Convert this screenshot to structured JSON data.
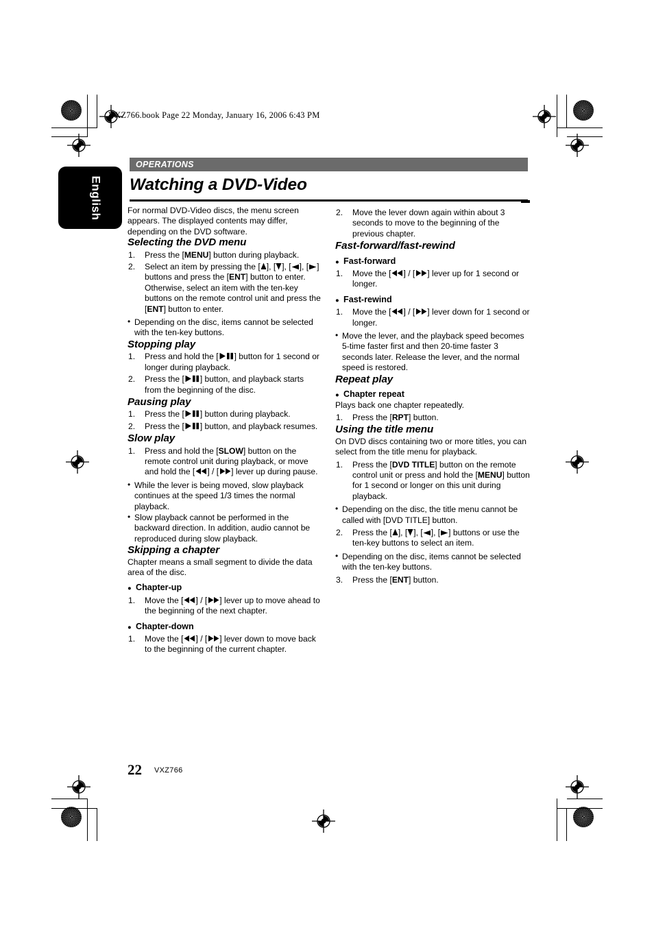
{
  "print_marks": {
    "file_line": "VXZ766.book  Page 22  Monday, January 16, 2006  6:43 PM"
  },
  "language_tab": {
    "label": "English"
  },
  "section_header": {
    "label": "OPERATIONS"
  },
  "page_title": "Watching a DVD-Video",
  "footer": {
    "page_number": "22",
    "model": "VXZ766"
  },
  "icons": {
    "up": "arrow-up-icon",
    "down": "arrow-down-icon",
    "left": "arrow-left-icon",
    "right": "arrow-right-icon",
    "play_pause": "play-pause-icon",
    "rewind": "fast-rewind-icon",
    "forward": "fast-forward-icon"
  },
  "left_column": {
    "intro": "For normal DVD-Video discs, the menu screen appears. The displayed contents may differ, depending on the DVD software.",
    "sections": [
      {
        "heading": "Selecting the DVD menu",
        "steps": [
          "Press the [MENU] button during playback.",
          "Select an item by pressing the [ ▲ ], [ ▼ ], [ ◀ ], [ ▶ ] buttons and press the [ENT] button to enter. Otherwise, select an item with the ten-key buttons on the remote control unit and press the [ENT] button to enter."
        ],
        "notes": [
          "Depending on the disc, items cannot be selected with the ten-key buttons."
        ]
      },
      {
        "heading": "Stopping play",
        "steps": [
          "Press and hold the [ ▶▐▐ ] button for 1 second or longer during playback.",
          "Press the [ ▶▐▐ ] button, and playback starts from the beginning of the disc."
        ],
        "notes": []
      },
      {
        "heading": "Pausing play",
        "steps": [
          "Press the [ ▶▐▐ ] button during playback.",
          "Press the [ ▶▐▐ ] button, and playback resumes."
        ],
        "notes": []
      },
      {
        "heading": "Slow play",
        "steps": [
          "Press and hold the [SLOW] button on the remote control unit during playback, or move and hold the [ ◀◀ ] / [ ▶▶ ] lever up during pause."
        ],
        "notes": [
          "While the lever is being moved, slow playback continues at the speed 1/3 times the normal playback.",
          "Slow playback cannot be performed in the backward direction. In addition, audio cannot be reproduced during slow playback."
        ]
      },
      {
        "heading": "Skipping a chapter",
        "lead": "Chapter means a small segment to divide the data area of the disc.",
        "subsections": [
          {
            "title": "Chapter-up",
            "steps": [
              "Move the [ ◀◀ ] / [ ▶▶ ] lever up to move ahead to the beginning of the next chapter."
            ]
          },
          {
            "title": "Chapter-down",
            "steps": [
              "Move the [ ◀◀ ] / [ ▶▶ ] lever down to move back to the beginning of the current chapter."
            ]
          }
        ]
      }
    ]
  },
  "right_column": {
    "continued_step": "Move the lever down again within about 3 seconds to move to the beginning of the previous chapter.",
    "sections": [
      {
        "heading": "Fast-forward/fast-rewind",
        "subsections": [
          {
            "title": "Fast-forward",
            "steps": [
              "Move the [ ◀◀ ] / [ ▶▶ ] lever up for 1 second or longer."
            ]
          },
          {
            "title": "Fast-rewind",
            "steps": [
              "Move the [ ◀◀ ] / [ ▶▶ ] lever down for 1 second or longer."
            ]
          }
        ],
        "notes": [
          "Move the lever, and the playback speed becomes 5-time faster first and then 20-time faster 3 seconds later. Release the lever, and the normal speed is restored."
        ]
      },
      {
        "heading": "Repeat play",
        "subsections": [
          {
            "title": "Chapter repeat",
            "lead": "Plays back one chapter repeatedly.",
            "steps": [
              "Press the [RPT] button."
            ]
          }
        ]
      },
      {
        "heading": "Using the title menu",
        "lead": "On DVD discs containing two or more titles, you can select from the title menu for playback.",
        "steps": [
          "Press the [DVD TITLE] button on the remote control unit or press and hold the [MENU] button for 1 second or longer on this unit during playback.",
          "Press the [ ▲ ], [ ▼ ], [ ◀ ], [ ▶ ] buttons or use the ten-key buttons to select an item.",
          "Press the [ENT] button."
        ],
        "notes_after_1": [
          "Depending on the disc, the title menu cannot be called with [DVD TITLE] button."
        ],
        "notes_after_2": [
          "Depending on the disc, items cannot be selected with the ten-key buttons."
        ]
      }
    ]
  }
}
